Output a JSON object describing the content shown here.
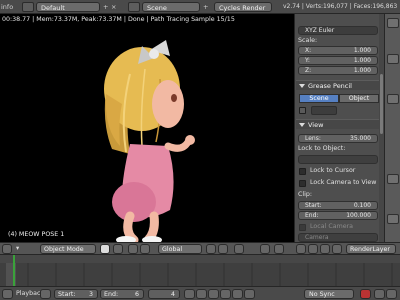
{
  "topbar": {
    "left_label": "info",
    "layout": "Default",
    "scene": "Scene",
    "engine": "Cycles Render",
    "stats_right": "v2.74 | Verts:196,077 | Faces:196,863"
  },
  "viewport": {
    "render_info": "00:38.77 | Mem:73.37M, Peak:73.37M | Done | Path Tracing Sample 15/15",
    "caption": "(4) MEOW POSE 1",
    "mode": "Object Mode",
    "orientation": "Global"
  },
  "properties": {
    "rotation_mode": "XYZ Euler",
    "scale_label": "Scale:",
    "scale": [
      {
        "axis": "X:",
        "value": "1.000"
      },
      {
        "axis": "Y:",
        "value": "1.000"
      },
      {
        "axis": "Z:",
        "value": "1.000"
      }
    ],
    "grease_pencil": "Grease Pencil",
    "tab_scene": "Scene",
    "tab_object": "Object",
    "view_section": "View",
    "lens_label": "Lens:",
    "lens_value": "35.000",
    "lock_object_label": "Lock to Object:",
    "lock_cursor": "Lock to Cursor",
    "lock_camera": "Lock Camera to View",
    "clip_label": "Clip:",
    "clip_start_label": "Start:",
    "clip_start_value": "0.100",
    "clip_end_label": "End:",
    "clip_end_value": "100.000",
    "local_camera": "Local Camera",
    "camera_field": "Camera",
    "render_layer": "RenderLayer"
  },
  "timeline": {
    "playback": "Playback",
    "start_label": "Start:",
    "start_value": "3",
    "end_label": "End:",
    "end_value": "6",
    "current_frame": "4",
    "sync": "No Sync",
    "ticks": [
      "0",
      "20",
      "40",
      "60",
      "80",
      "100",
      "120",
      "140",
      "160",
      "180",
      "200",
      "220",
      "240",
      "260"
    ]
  },
  "colors": {
    "accent_blue": "#5680c2",
    "playhead_green": "#3aa23a",
    "viewport_bg": "#000000"
  }
}
